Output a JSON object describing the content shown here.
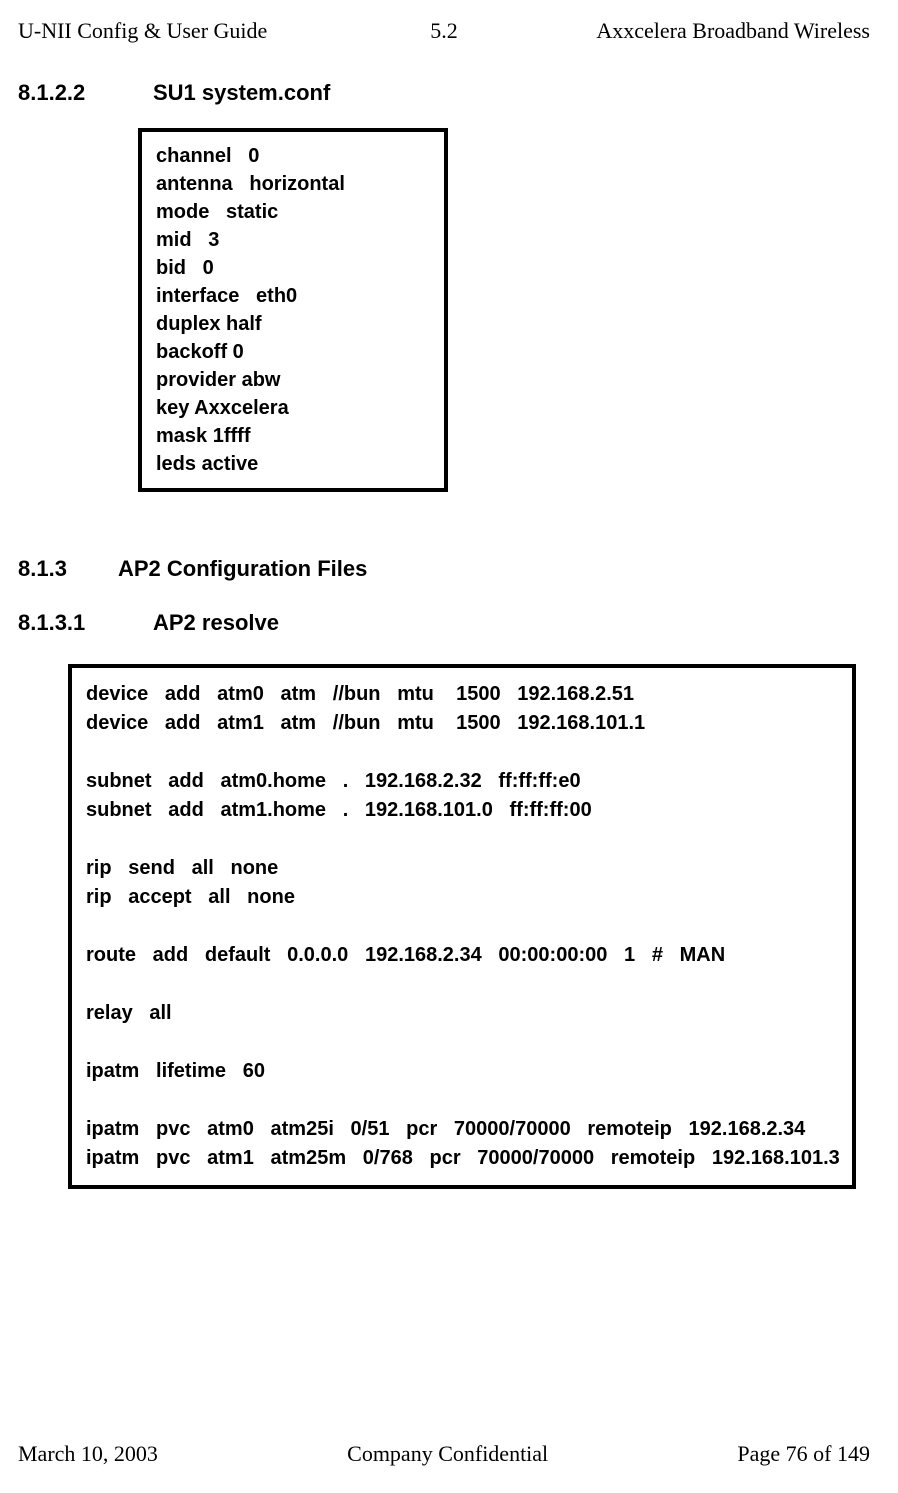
{
  "header": {
    "left": "U-NII Config & User Guide",
    "center": "5.2",
    "right": "Axxcelera Broadband Wireless"
  },
  "sections": {
    "s1": {
      "num": "8.1.2.2",
      "title": "SU1 system.conf"
    },
    "s2": {
      "num": "8.1.3",
      "title": "AP2 Configuration Files"
    },
    "s3": {
      "num": "8.1.3.1",
      "title": "AP2 resolve"
    }
  },
  "config_small": "channel   0\nantenna   horizontal\nmode   static\nmid   3\nbid   0\ninterface   eth0\nduplex half\nbackoff 0\nprovider abw\nkey Axxcelera\nmask 1ffff\nleds active",
  "config_large": "device   add   atm0   atm   //bun   mtu    1500   192.168.2.51\ndevice   add   atm1   atm   //bun   mtu    1500   192.168.101.1\n\nsubnet   add   atm0.home   .   192.168.2.32   ff:ff:ff:e0\nsubnet   add   atm1.home   .   192.168.101.0   ff:ff:ff:00\n\nrip   send   all   none\nrip   accept   all   none\n\nroute   add   default   0.0.0.0   192.168.2.34   00:00:00:00   1   #   MAN\n\nrelay   all\n\nipatm   lifetime   60\n\nipatm   pvc   atm0   atm25i   0/51   pcr   70000/70000   remoteip   192.168.2.34\nipatm   pvc   atm1   atm25m   0/768   pcr   70000/70000   remoteip   192.168.101.3",
  "footer": {
    "left": "March 10, 2003",
    "center": "Company Confidential",
    "right": "Page 76 of 149"
  }
}
